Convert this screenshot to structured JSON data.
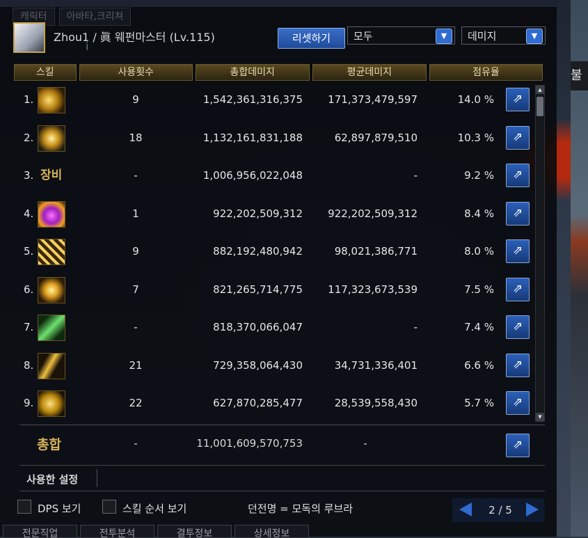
{
  "top_tabs": [
    "캐릭터",
    "아바타,크리쳐"
  ],
  "player": {
    "name": "Zhou1",
    "title": "眞 웨펀마스터 (Lv.115)"
  },
  "controls": {
    "reset_label": "리셋하기",
    "filter_selected": "모두",
    "mode_selected": "데미지",
    "info_icon": "i"
  },
  "table": {
    "headers": [
      "스킬",
      "사용횟수",
      "총합데미지",
      "평균데미지",
      "점유율"
    ],
    "rows": [
      {
        "rank": "1.",
        "icon": "skill-icon-1",
        "uses": "9",
        "total": "1,542,361,316,375",
        "avg": "171,373,479,597",
        "share": "14.0 %"
      },
      {
        "rank": "2.",
        "icon": "skill-icon-2",
        "uses": "18",
        "total": "1,132,161,831,188",
        "avg": "62,897,879,510",
        "share": "10.3 %"
      },
      {
        "rank": "3.",
        "equip": "장비",
        "uses": "-",
        "total": "1,006,956,022,048",
        "avg": "-",
        "share": "9.2 %"
      },
      {
        "rank": "4.",
        "icon": "skill-icon-4",
        "uses": "1",
        "total": "922,202,509,312",
        "avg": "922,202,509,312",
        "share": "8.4 %"
      },
      {
        "rank": "5.",
        "icon": "skill-icon-5",
        "uses": "9",
        "total": "882,192,480,942",
        "avg": "98,021,386,771",
        "share": "8.0 %"
      },
      {
        "rank": "6.",
        "icon": "skill-icon-6",
        "uses": "7",
        "total": "821,265,714,775",
        "avg": "117,323,673,539",
        "share": "7.5 %"
      },
      {
        "rank": "7.",
        "icon": "skill-icon-7",
        "uses": "-",
        "total": "818,370,066,047",
        "avg": "-",
        "share": "7.4 %"
      },
      {
        "rank": "8.",
        "icon": "skill-icon-8",
        "uses": "21",
        "total": "729,358,064,430",
        "avg": "34,731,336,401",
        "share": "6.6 %"
      },
      {
        "rank": "9.",
        "icon": "skill-icon-9",
        "uses": "22",
        "total": "627,870,285,477",
        "avg": "28,539,558,430",
        "share": "5.7 %"
      }
    ]
  },
  "summary": {
    "label": "총합",
    "uses": "-",
    "total": "11,001,609,570,753",
    "avg": "-"
  },
  "settings": {
    "label": "사용한 설정"
  },
  "options": {
    "dps_label": "DPS 보기",
    "skill_order_label": "스킬 순서 보기",
    "dungeon_text": "던전명 = 모독의 루브라"
  },
  "pager": {
    "text": "2 / 5"
  },
  "bottom_tabs": [
    "전문직업",
    "전투분석",
    "결투정보",
    "상세정보"
  ],
  "right_edge_text": "불",
  "colors": {
    "accent_blue": "#2f6bd0",
    "gold": "#d8b35a"
  }
}
